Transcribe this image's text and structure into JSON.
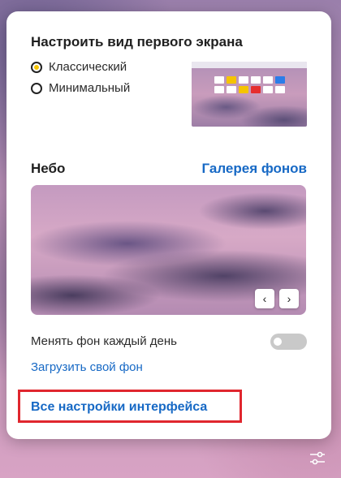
{
  "first_screen": {
    "title": "Настроить вид первого экрана",
    "options": [
      {
        "label": "Классический",
        "selected": true
      },
      {
        "label": "Минимальный",
        "selected": false
      }
    ]
  },
  "background": {
    "section_title": "Небо",
    "gallery_link": "Галерея фонов",
    "prev_button": "‹",
    "next_button": "›",
    "daily_change_label": "Менять фон каждый день",
    "daily_change_enabled": false,
    "upload_link": "Загрузить свой фон"
  },
  "footer": {
    "all_settings_link": "Все настройки интерфейса"
  },
  "icons": {
    "radio_checked": "radio-checked-icon",
    "settings": "sliders-icon"
  },
  "colors": {
    "accent_link": "#1769c5",
    "radio_dot": "#f5c400",
    "highlight_box": "#e0262e"
  }
}
